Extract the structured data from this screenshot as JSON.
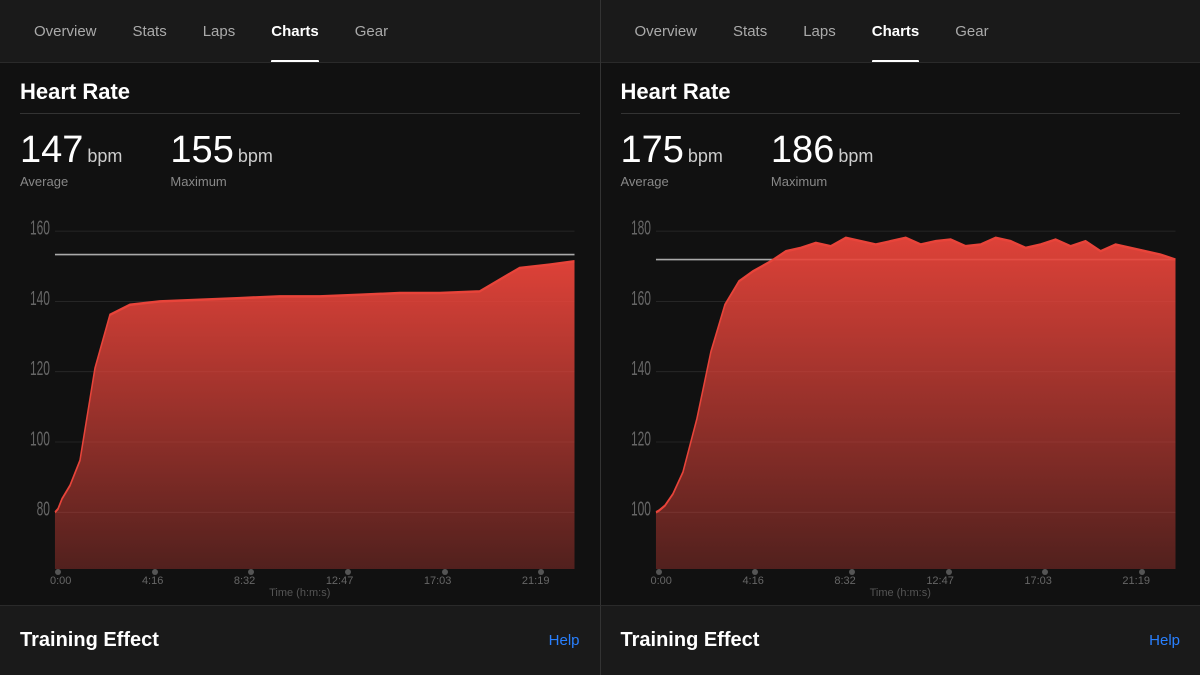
{
  "left": {
    "nav": {
      "tabs": [
        {
          "label": "Overview",
          "active": false
        },
        {
          "label": "Stats",
          "active": false
        },
        {
          "label": "Laps",
          "active": false
        },
        {
          "label": "Charts",
          "active": true
        },
        {
          "label": "Gear",
          "active": false
        }
      ]
    },
    "heartRate": {
      "title": "Heart Rate",
      "average": {
        "value": "147",
        "unit": "bpm",
        "label": "Average"
      },
      "maximum": {
        "value": "155",
        "unit": "bpm",
        "label": "Maximum"
      }
    },
    "chart": {
      "yLabels": [
        "160",
        "140",
        "120",
        "100",
        "80"
      ],
      "yMax": 165,
      "yMin": 75
    },
    "timeAxis": {
      "ticks": [
        "0:00",
        "4:16",
        "8:32",
        "12:47",
        "17:03",
        "21:19"
      ],
      "label": "Time (h:m:s)"
    },
    "footer": {
      "title": "Training Effect",
      "help": "Help"
    }
  },
  "right": {
    "nav": {
      "tabs": [
        {
          "label": "Overview",
          "active": false
        },
        {
          "label": "Stats",
          "active": false
        },
        {
          "label": "Laps",
          "active": false
        },
        {
          "label": "Charts",
          "active": true
        },
        {
          "label": "Gear",
          "active": false
        }
      ]
    },
    "heartRate": {
      "title": "Heart Rate",
      "average": {
        "value": "175",
        "unit": "bpm",
        "label": "Average"
      },
      "maximum": {
        "value": "186",
        "unit": "bpm",
        "label": "Maximum"
      }
    },
    "chart": {
      "yLabels": [
        "180",
        "160",
        "140",
        "120",
        "100"
      ],
      "yMax": 190,
      "yMin": 92
    },
    "timeAxis": {
      "ticks": [
        "0:00",
        "4:16",
        "8:32",
        "12:47",
        "17:03",
        "21:19"
      ],
      "label": "Time (h:m:s)"
    },
    "footer": {
      "title": "Training Effect",
      "help": "Help"
    }
  },
  "colors": {
    "accent": "#2980ff",
    "chartFill": "#e8443a",
    "avgLine": "#ccc"
  }
}
